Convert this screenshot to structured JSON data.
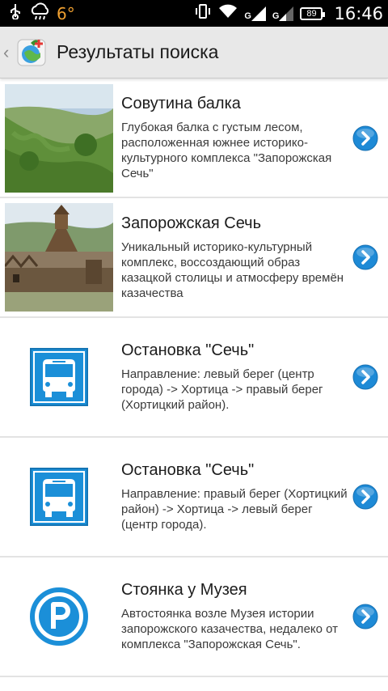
{
  "status": {
    "temperature": "6°",
    "net1": "G",
    "net2": "G",
    "battery": "89",
    "time": "16:46"
  },
  "header": {
    "title": "Результаты поиска"
  },
  "items": [
    {
      "title": "Совутина балка",
      "description": "Глубокая балка с густым лесом, расположенная южнее историко-культурного комплекса \"Запорожская Сечь\"",
      "thumb": "photo-ravine"
    },
    {
      "title": "Запорожская Сечь",
      "description": "Уникальный историко-культурный комплекс, воссоздающий образ казацкой столицы и атмосферу времён казачества",
      "thumb": "photo-sich-fortress"
    },
    {
      "title": "Остановка \"Сечь\"",
      "description": "Направление: левый берег (центр города) -> Хортица -> правый берег (Хортицкий район).",
      "thumb": "bus-stop-icon"
    },
    {
      "title": "Остановка \"Сечь\"",
      "description": "Направление: правый берег (Хортицкий район) -> Хортица -> левый берег (центр города).",
      "thumb": "bus-stop-icon"
    },
    {
      "title": "Стоянка у Музея",
      "description": "Автостоянка возле Музея истории запорожского казачества, недалеко от комплекса \"Запорожская Сечь\".",
      "thumb": "parking-icon"
    }
  ],
  "colors": {
    "accent_blue": "#1e8ad6",
    "bus_sign_blue": "#1b8fd8",
    "actionbar": "#e8e8e8"
  }
}
